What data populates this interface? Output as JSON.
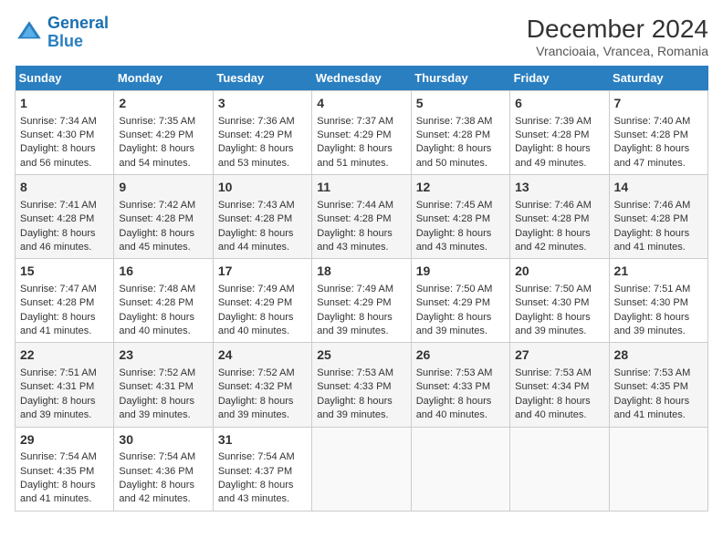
{
  "header": {
    "logo_line1": "General",
    "logo_line2": "Blue",
    "title": "December 2024",
    "subtitle": "Vrancioaia, Vrancea, Romania"
  },
  "days_of_week": [
    "Sunday",
    "Monday",
    "Tuesday",
    "Wednesday",
    "Thursday",
    "Friday",
    "Saturday"
  ],
  "weeks": [
    [
      {
        "day": "1",
        "sunrise": "7:34 AM",
        "sunset": "4:30 PM",
        "daylight": "8 hours and 56 minutes."
      },
      {
        "day": "2",
        "sunrise": "7:35 AM",
        "sunset": "4:29 PM",
        "daylight": "8 hours and 54 minutes."
      },
      {
        "day": "3",
        "sunrise": "7:36 AM",
        "sunset": "4:29 PM",
        "daylight": "8 hours and 53 minutes."
      },
      {
        "day": "4",
        "sunrise": "7:37 AM",
        "sunset": "4:29 PM",
        "daylight": "8 hours and 51 minutes."
      },
      {
        "day": "5",
        "sunrise": "7:38 AM",
        "sunset": "4:28 PM",
        "daylight": "8 hours and 50 minutes."
      },
      {
        "day": "6",
        "sunrise": "7:39 AM",
        "sunset": "4:28 PM",
        "daylight": "8 hours and 49 minutes."
      },
      {
        "day": "7",
        "sunrise": "7:40 AM",
        "sunset": "4:28 PM",
        "daylight": "8 hours and 47 minutes."
      }
    ],
    [
      {
        "day": "8",
        "sunrise": "7:41 AM",
        "sunset": "4:28 PM",
        "daylight": "8 hours and 46 minutes."
      },
      {
        "day": "9",
        "sunrise": "7:42 AM",
        "sunset": "4:28 PM",
        "daylight": "8 hours and 45 minutes."
      },
      {
        "day": "10",
        "sunrise": "7:43 AM",
        "sunset": "4:28 PM",
        "daylight": "8 hours and 44 minutes."
      },
      {
        "day": "11",
        "sunrise": "7:44 AM",
        "sunset": "4:28 PM",
        "daylight": "8 hours and 43 minutes."
      },
      {
        "day": "12",
        "sunrise": "7:45 AM",
        "sunset": "4:28 PM",
        "daylight": "8 hours and 43 minutes."
      },
      {
        "day": "13",
        "sunrise": "7:46 AM",
        "sunset": "4:28 PM",
        "daylight": "8 hours and 42 minutes."
      },
      {
        "day": "14",
        "sunrise": "7:46 AM",
        "sunset": "4:28 PM",
        "daylight": "8 hours and 41 minutes."
      }
    ],
    [
      {
        "day": "15",
        "sunrise": "7:47 AM",
        "sunset": "4:28 PM",
        "daylight": "8 hours and 41 minutes."
      },
      {
        "day": "16",
        "sunrise": "7:48 AM",
        "sunset": "4:28 PM",
        "daylight": "8 hours and 40 minutes."
      },
      {
        "day": "17",
        "sunrise": "7:49 AM",
        "sunset": "4:29 PM",
        "daylight": "8 hours and 40 minutes."
      },
      {
        "day": "18",
        "sunrise": "7:49 AM",
        "sunset": "4:29 PM",
        "daylight": "8 hours and 39 minutes."
      },
      {
        "day": "19",
        "sunrise": "7:50 AM",
        "sunset": "4:29 PM",
        "daylight": "8 hours and 39 minutes."
      },
      {
        "day": "20",
        "sunrise": "7:50 AM",
        "sunset": "4:30 PM",
        "daylight": "8 hours and 39 minutes."
      },
      {
        "day": "21",
        "sunrise": "7:51 AM",
        "sunset": "4:30 PM",
        "daylight": "8 hours and 39 minutes."
      }
    ],
    [
      {
        "day": "22",
        "sunrise": "7:51 AM",
        "sunset": "4:31 PM",
        "daylight": "8 hours and 39 minutes."
      },
      {
        "day": "23",
        "sunrise": "7:52 AM",
        "sunset": "4:31 PM",
        "daylight": "8 hours and 39 minutes."
      },
      {
        "day": "24",
        "sunrise": "7:52 AM",
        "sunset": "4:32 PM",
        "daylight": "8 hours and 39 minutes."
      },
      {
        "day": "25",
        "sunrise": "7:53 AM",
        "sunset": "4:33 PM",
        "daylight": "8 hours and 39 minutes."
      },
      {
        "day": "26",
        "sunrise": "7:53 AM",
        "sunset": "4:33 PM",
        "daylight": "8 hours and 40 minutes."
      },
      {
        "day": "27",
        "sunrise": "7:53 AM",
        "sunset": "4:34 PM",
        "daylight": "8 hours and 40 minutes."
      },
      {
        "day": "28",
        "sunrise": "7:53 AM",
        "sunset": "4:35 PM",
        "daylight": "8 hours and 41 minutes."
      }
    ],
    [
      {
        "day": "29",
        "sunrise": "7:54 AM",
        "sunset": "4:35 PM",
        "daylight": "8 hours and 41 minutes."
      },
      {
        "day": "30",
        "sunrise": "7:54 AM",
        "sunset": "4:36 PM",
        "daylight": "8 hours and 42 minutes."
      },
      {
        "day": "31",
        "sunrise": "7:54 AM",
        "sunset": "4:37 PM",
        "daylight": "8 hours and 43 minutes."
      },
      null,
      null,
      null,
      null
    ]
  ],
  "labels": {
    "sunrise": "Sunrise:",
    "sunset": "Sunset:",
    "daylight": "Daylight:"
  }
}
